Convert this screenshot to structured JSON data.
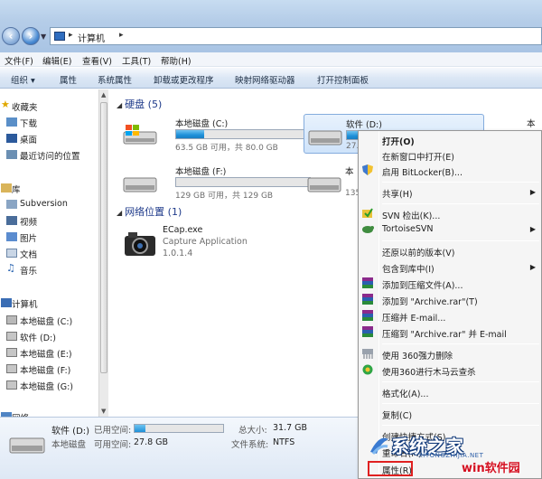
{
  "address": {
    "crumb": "计算机"
  },
  "menu": [
    "文件(F)",
    "编辑(E)",
    "查看(V)",
    "工具(T)",
    "帮助(H)"
  ],
  "toolbar": {
    "organize": "组织 ▾",
    "properties": "属性",
    "system_properties": "系统属性",
    "uninstall": "卸载或更改程序",
    "map_drive": "映射网络驱动器",
    "control_panel": "打开控制面板"
  },
  "sidebar": {
    "favorites": "收藏夹",
    "downloads": "下载",
    "desktop": "桌面",
    "recent": "最近访问的位置",
    "libraries": "库",
    "subversion": "Subversion",
    "videos": "视频",
    "pictures": "图片",
    "documents": "文档",
    "music": "音乐",
    "computer": "计算机",
    "drive_c": "本地磁盘 (C:)",
    "drive_d": "软件 (D:)",
    "drive_e": "本地磁盘 (E:)",
    "drive_f": "本地磁盘 (F:)",
    "drive_g": "本地磁盘 (G:)",
    "network": "网络"
  },
  "content": {
    "hdd_group": "硬盘 (5)",
    "network_group": "网络位置 (1)",
    "drive_c": {
      "name": "本地磁盘 (C:)",
      "info": "63.5 GB 可用，共 80.0 GB",
      "used_fraction": 0.21
    },
    "drive_d": {
      "name": "软件 (D:)",
      "info": "27.",
      "used_fraction": 0.12
    },
    "drive_f": {
      "name": "本地磁盘 (F:)",
      "info": "129 GB 可用，共 129 GB",
      "used_fraction": 0.0
    },
    "drive_x": {
      "name": "本",
      "info": "135"
    },
    "partial_right": "本",
    "ecap": {
      "name": "ECap.exe",
      "desc": "Capture Application",
      "version": "1.0.1.4"
    }
  },
  "details": {
    "name": "软件 (D:)",
    "used_label": "已用空间:",
    "free_label": "可用空间:",
    "free_value": "27.8 GB",
    "type": "本地磁盘",
    "total_label": "总大小:",
    "total_value": "31.7 GB",
    "fs_label": "文件系统:",
    "fs_value": "NTFS"
  },
  "context_menu": {
    "open": "打开(O)",
    "open_new": "在新窗口中打开(E)",
    "bitlocker": "启用 BitLocker(B)...",
    "share": "共享(H)",
    "svn_checkout": "SVN 检出(K)...",
    "tortoise": "TortoiseSVN",
    "restore": "还原以前的版本(V)",
    "include_lib": "包含到库中(I)",
    "add_archive": "添加到压缩文件(A)...",
    "add_rar": "添加到 \"Archive.rar\"(T)",
    "compress_email": "压缩并 E-mail...",
    "compress_rar_email": "压缩到 \"Archive.rar\" 并 E-mail",
    "del_360": "使用 360强力删除",
    "scan_360": "使用360进行木马云查杀",
    "format": "格式化(A)...",
    "copy": "复制(C)",
    "shortcut": "创建快捷方式(S)",
    "rename": "重命名(M)",
    "properties": "属性(R)"
  },
  "watermark": {
    "line1": "系统之家",
    "line2": "XITONGZHIJIA.NET",
    "line3": "win软件园"
  }
}
